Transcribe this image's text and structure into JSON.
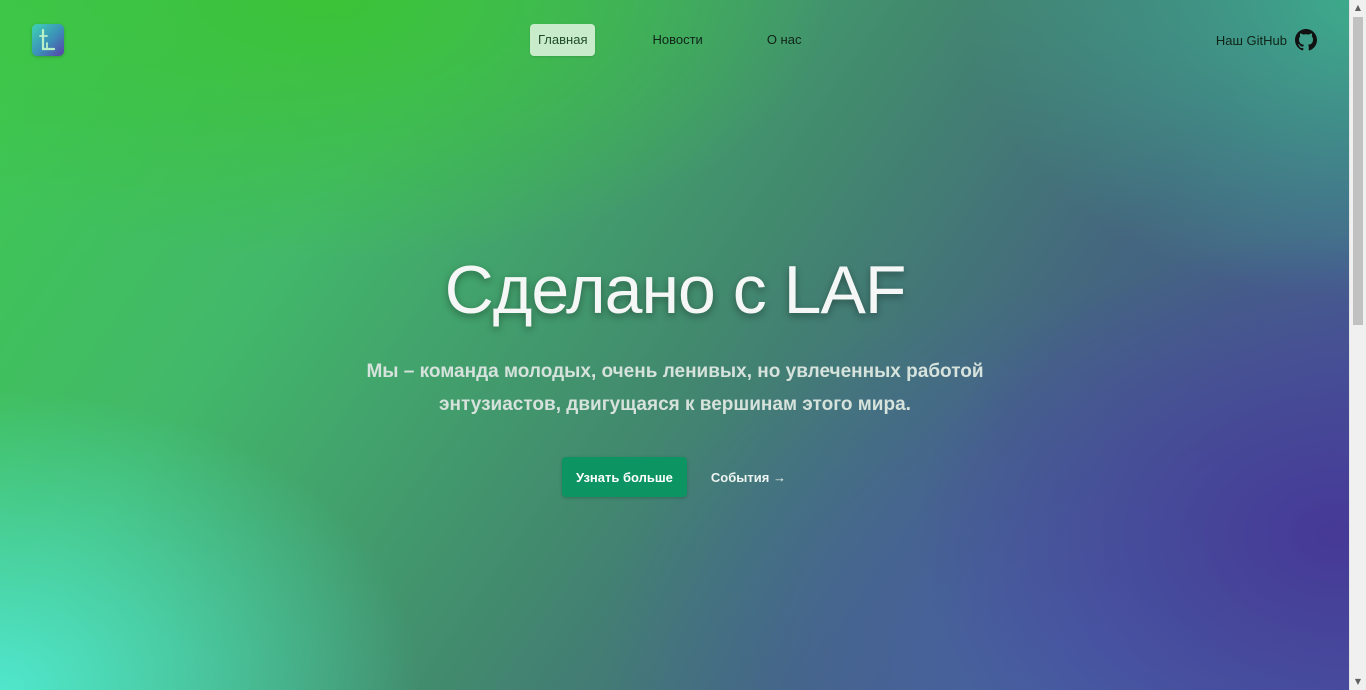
{
  "header": {
    "logo_name": "laf-logo",
    "nav": [
      {
        "label": "Главная",
        "active": true
      },
      {
        "label": "Новости",
        "active": false
      },
      {
        "label": "О нас",
        "active": false
      }
    ],
    "github_label": "Наш GitHub",
    "github_icon": "github-icon"
  },
  "hero": {
    "title": "Сделано с LAF",
    "subtitle": "Мы – команда молодых, очень ленивых, но увлеченных работой энтузиастов, двигущаяся к вершинам этого мира.",
    "primary_button": "Узнать больше",
    "secondary_link": "События →"
  },
  "colors": {
    "primary_button": "#0d9463",
    "active_nav_bg": "#e1f5e1",
    "gradient_green": "#3ec94f",
    "gradient_purple": "#46379a",
    "gradient_teal": "#50e6cd"
  },
  "scrollbar": {
    "up_icon": "scroll-up-arrow-icon",
    "down_icon": "scroll-down-arrow-icon",
    "position": 0
  }
}
